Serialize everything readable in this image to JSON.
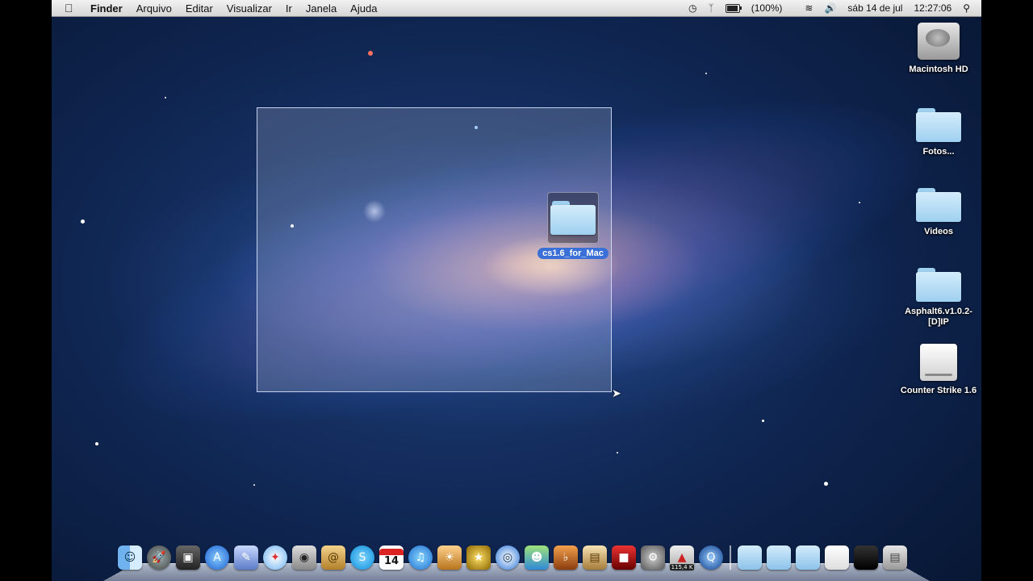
{
  "menubar": {
    "app": "Finder",
    "items": [
      "Arquivo",
      "Editar",
      "Visualizar",
      "Ir",
      "Janela",
      "Ajuda"
    ],
    "status": {
      "battery": "(100%)",
      "date": "sáb 14 de jul",
      "time": "12:27:06"
    }
  },
  "desktop": {
    "icons": [
      {
        "label": "Macintosh HD",
        "kind": "hard-drive-icon"
      },
      {
        "label": "Fotos...",
        "kind": "folder-icon"
      },
      {
        "label": "Videos",
        "kind": "folder-icon"
      },
      {
        "label": "Asphalt6.v1.0.2-[D]IP",
        "kind": "folder-icon"
      },
      {
        "label": "Counter Strike 1.6",
        "kind": "disk-image-icon"
      }
    ],
    "selected_folder": {
      "label": "cs1.6_for_Mac"
    }
  },
  "dock": {
    "items": [
      "finder-icon",
      "launchpad-icon",
      "photo-booth-icon",
      "app-store-icon",
      "preview-icon",
      "safari-icon",
      "facetime-icon",
      "address-book-icon",
      "skype-icon",
      "ical-icon",
      "itunes-icon",
      "iphoto-icon",
      "imovie-icon",
      "dvd-player-icon",
      "messenger-icon",
      "garageband-icon",
      "keynote-icon",
      "photo-icon",
      "system-preferences-icon",
      "transmission-icon",
      "quicktime-icon"
    ],
    "calendar_day": "14",
    "speed_badge": "115,4 K",
    "stacks": [
      "applications-stack-icon",
      "documents-stack-icon",
      "downloads-stack-icon"
    ],
    "trash": "trash-icon"
  }
}
